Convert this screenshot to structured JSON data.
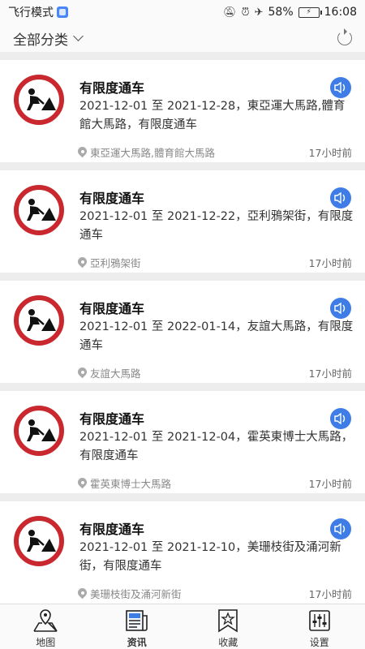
{
  "status_bar": {
    "mode": "飞行模式",
    "battery": "58%",
    "time": "16:08",
    "icons": [
      "mute-icon",
      "alarm-icon",
      "airplane-icon",
      "battery-icon"
    ]
  },
  "filter": {
    "label": "全部分类"
  },
  "cards": [
    {
      "title": "有限度通车",
      "desc": "2021-12-01 至 2021-12-28，東亞運大馬路,體育館大馬路，有限度通车",
      "location": "東亞運大馬路,體育館大馬路",
      "time": "17小时前"
    },
    {
      "title": "有限度通车",
      "desc": "2021-12-01 至 2021-12-22，亞利鴉架街，有限度通车",
      "location": "亞利鴉架街",
      "time": "17小时前"
    },
    {
      "title": "有限度通车",
      "desc": "2021-12-01 至 2022-01-14，友誼大馬路，有限度通车",
      "location": "友誼大馬路",
      "time": "17小时前"
    },
    {
      "title": "有限度通车",
      "desc": "2021-12-01 至 2021-12-04，霍英東博士大馬路，有限度通车",
      "location": "霍英東博士大馬路",
      "time": "17小时前"
    },
    {
      "title": "有限度通车",
      "desc": "2021-12-01 至 2021-12-10，美珊枝街及涌河新街，有限度通车",
      "location": "美珊枝街及涌河新街",
      "time": "17小时前"
    }
  ],
  "nav": [
    {
      "label": "地图",
      "icon": "map-icon"
    },
    {
      "label": "资讯",
      "icon": "news-icon",
      "active": true
    },
    {
      "label": "收藏",
      "icon": "bookmark-star-icon"
    },
    {
      "label": "设置",
      "icon": "settings-sliders-icon"
    }
  ],
  "colors": {
    "accent": "#3f7de6",
    "sign_red": "#c9292e",
    "background": "#ededed"
  }
}
